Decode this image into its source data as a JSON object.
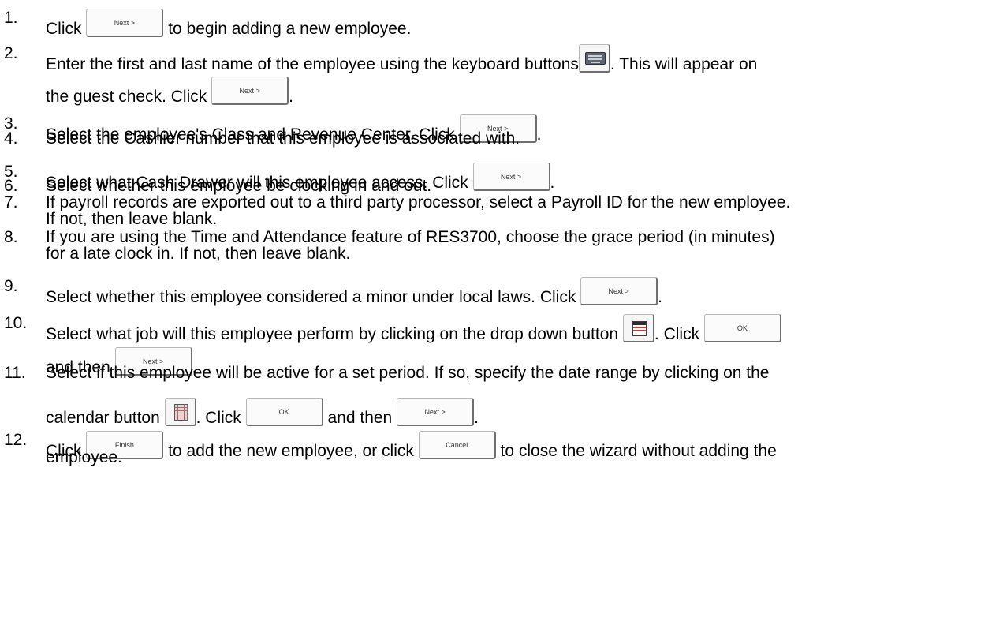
{
  "buttons": {
    "next": "Next >",
    "ok": "OK",
    "finish": "Finish",
    "cancel": "Cancel"
  },
  "steps": [
    {
      "num": "1.",
      "lines": [
        "Click",
        "to begin adding a new employee."
      ]
    },
    {
      "num": "2.",
      "lines": [
        "Enter the first and last name of the employee using the keyboard buttons",
        ".  This will appear on",
        "the guest check. Click",
        "."
      ]
    },
    {
      "num": "3.",
      "lines": [
        "Select the employee's Class and Revenue Center. Click",
        "."
      ]
    },
    {
      "num": "4.",
      "lines": [
        "Select the Cashier number that this employee is associated with."
      ]
    },
    {
      "num": "5.",
      "lines": [
        "Select what Cash Drawer will this employee access. Click",
        "."
      ]
    },
    {
      "num": "6.",
      "lines": [
        "Select whether this employee be clocking in and out."
      ]
    },
    {
      "num": "7.",
      "lines": [
        "If payroll records are exported out to a third party processor, select a Payroll ID for the new employee.",
        "If not, then leave blank."
      ]
    },
    {
      "num": "8.",
      "lines": [
        "If you are using the Time and Attendance feature of RES3700, choose the grace period (in minutes)",
        "for a late clock in.  If not, then leave blank."
      ]
    },
    {
      "num": "9.",
      "lines": [
        "Select whether this employee considered a minor under local laws.  Click",
        "."
      ]
    },
    {
      "num": "10.",
      "lines": [
        "Select what job will this employee perform by clicking on the drop down button",
        ". Click",
        "and then",
        "."
      ]
    },
    {
      "num": "11.",
      "lines": [
        "Select if this employee will be active for a set period. If so, specify the date range by clicking on the",
        "calendar button",
        ".  Click",
        "and then",
        "."
      ]
    },
    {
      "num": "12.",
      "lines": [
        "Click",
        "to add the new employee, or click",
        "to close the wizard without adding the",
        "employee."
      ]
    }
  ],
  "icons": [
    "keyboard-icon",
    "dropdown-list-icon",
    "calendar-icon"
  ]
}
